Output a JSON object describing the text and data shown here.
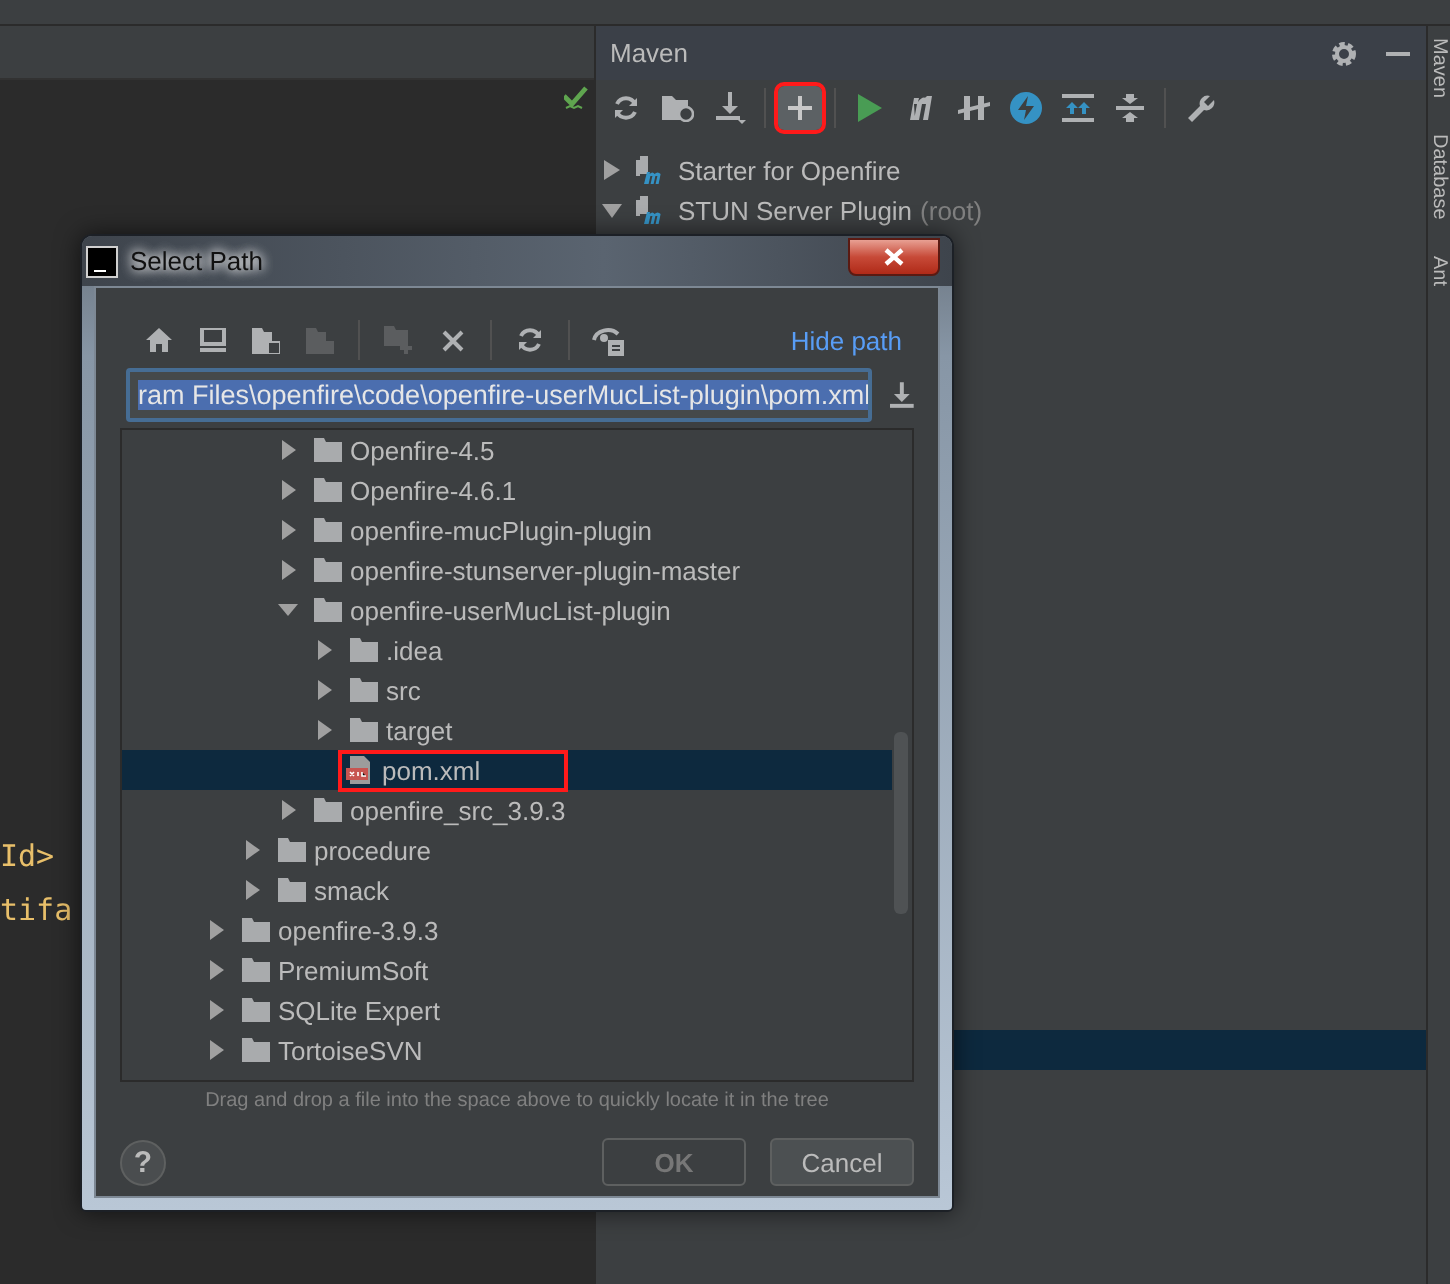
{
  "editor": {
    "code_lines": [
      "Id>",
      "tifa"
    ],
    "inspection_ok": true
  },
  "maven": {
    "title": "Maven",
    "toolbar": [
      {
        "kind": "refresh",
        "highlighted": false
      },
      {
        "kind": "folder-add",
        "highlighted": false
      },
      {
        "kind": "download",
        "highlighted": false
      },
      {
        "kind": "add",
        "highlighted": true
      },
      {
        "kind": "run",
        "highlighted": false
      },
      {
        "kind": "m",
        "highlighted": false
      },
      {
        "kind": "skip",
        "highlighted": false
      },
      {
        "kind": "offline",
        "highlighted": false
      },
      {
        "kind": "expand",
        "highlighted": false
      },
      {
        "kind": "collapse",
        "highlighted": false
      },
      {
        "kind": "wrench",
        "highlighted": false
      }
    ],
    "items": [
      {
        "label": "Starter for Openfire",
        "expanded": false
      },
      {
        "label": "STUN Server Plugin",
        "note": "(root)",
        "expanded": true
      }
    ],
    "covered_row_selected": true
  },
  "side_tabs": [
    "Maven",
    "Database",
    "Ant"
  ],
  "dialog": {
    "title": "Select Path",
    "toolbar": [
      {
        "kind": "home",
        "disabled": false
      },
      {
        "kind": "desktop",
        "disabled": false
      },
      {
        "kind": "project-folder",
        "disabled": false
      },
      {
        "kind": "module-folder",
        "disabled": true
      },
      {
        "kind": "new-folder",
        "disabled": true
      },
      {
        "kind": "delete",
        "disabled": false
      },
      {
        "kind": "refresh",
        "disabled": false
      },
      {
        "kind": "hidden-files",
        "disabled": false
      }
    ],
    "hide_path": "Hide path",
    "path": "ram Files\\openfire\\code\\openfire-userMucList-plugin\\pom.xml",
    "tree": [
      {
        "children": [
          {
            "children": [
              {
                "label": "Openfire-4.5",
                "kind": "folder",
                "expanded": false,
                "selected": false,
                "highlighted": false
              },
              {
                "label": "Openfire-4.6.1",
                "kind": "folder",
                "expanded": false,
                "selected": false,
                "highlighted": false
              },
              {
                "label": "openfire-mucPlugin-plugin",
                "kind": "folder",
                "expanded": false,
                "selected": false,
                "highlighted": false
              },
              {
                "label": "openfire-stunserver-plugin-master",
                "kind": "folder",
                "expanded": false,
                "selected": false,
                "highlighted": false
              },
              {
                "label": "openfire-userMucList-plugin",
                "kind": "folder",
                "expanded": true,
                "selected": false,
                "highlighted": false,
                "children": [
                  {
                    "label": ".idea",
                    "kind": "folder",
                    "expanded": false,
                    "selected": false,
                    "highlighted": false
                  },
                  {
                    "label": "src",
                    "kind": "folder",
                    "expanded": false,
                    "selected": false,
                    "highlighted": false
                  },
                  {
                    "label": "target",
                    "kind": "folder",
                    "expanded": false,
                    "selected": false,
                    "highlighted": false
                  },
                  {
                    "label": "pom.xml",
                    "kind": "file",
                    "selected": true,
                    "highlighted": true
                  }
                ]
              },
              {
                "label": "openfire_src_3.9.3",
                "kind": "folder",
                "expanded": false,
                "selected": false,
                "highlighted": false
              }
            ]
          },
          {
            "label": "procedure",
            "kind": "folder",
            "expanded": false,
            "selected": false,
            "highlighted": false
          },
          {
            "label": "smack",
            "kind": "folder",
            "expanded": false,
            "selected": false,
            "highlighted": false
          }
        ]
      },
      {
        "label": "openfire-3.9.3",
        "kind": "folder",
        "expanded": false,
        "selected": false,
        "highlighted": false
      },
      {
        "label": "PremiumSoft",
        "kind": "folder",
        "expanded": false,
        "selected": false,
        "highlighted": false
      },
      {
        "label": "SQLite Expert",
        "kind": "folder",
        "expanded": false,
        "selected": false,
        "highlighted": false
      },
      {
        "label": "TortoiseSVN",
        "kind": "folder",
        "expanded": false,
        "selected": false,
        "highlighted": false
      }
    ],
    "hint": "Drag and drop a file into the space above to quickly locate it in the tree",
    "help": "?",
    "buttons": [
      {
        "label": "OK",
        "disabled": true
      },
      {
        "label": "Cancel",
        "disabled": false
      }
    ]
  }
}
